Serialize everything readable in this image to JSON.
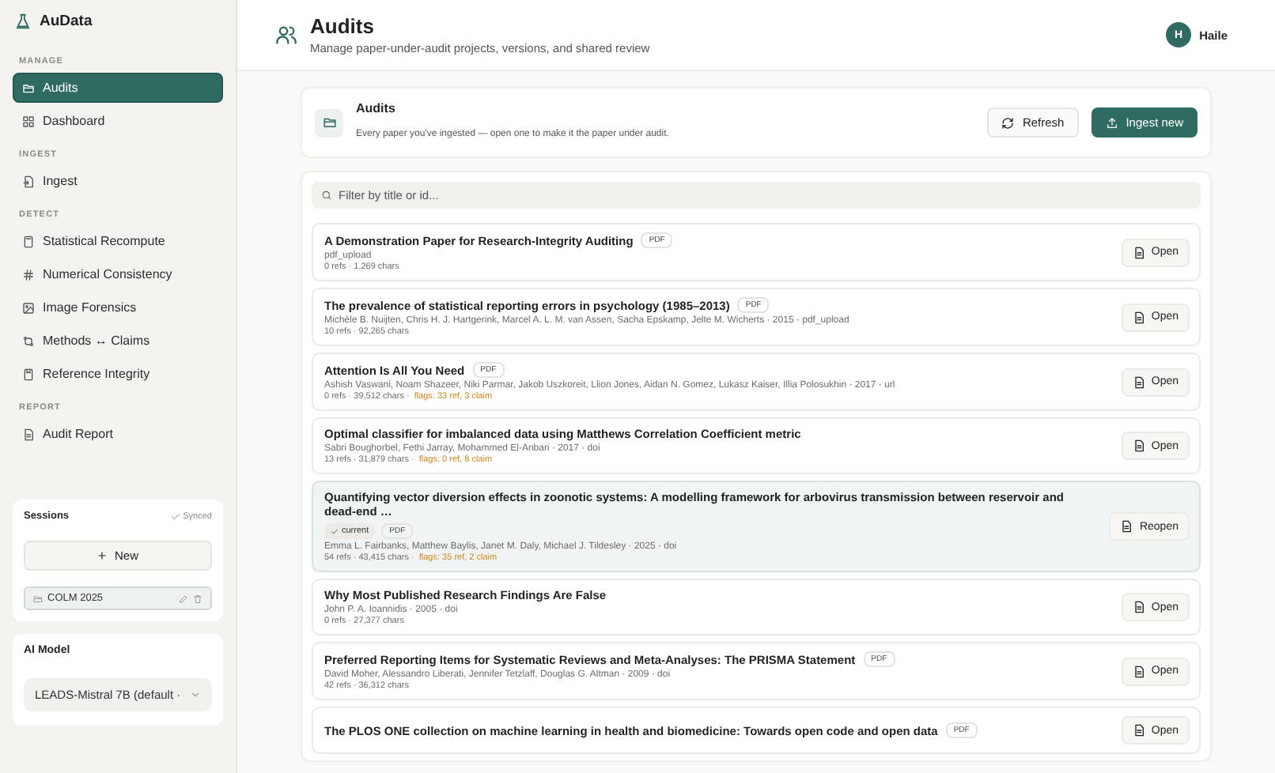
{
  "brand": {
    "name": "AuData"
  },
  "sidebar": {
    "sections": [
      {
        "heading": "MANAGE",
        "items": [
          {
            "label": "Audits",
            "selected": true
          },
          {
            "label": "Dashboard",
            "selected": false
          }
        ]
      },
      {
        "heading": "INGEST",
        "items": [
          {
            "label": "Ingest",
            "selected": false
          }
        ]
      },
      {
        "heading": "DETECT",
        "items": [
          {
            "label": "Statistical Recompute",
            "selected": false
          },
          {
            "label": "Numerical Consistency",
            "selected": false
          },
          {
            "label": "Image Forensics",
            "selected": false
          },
          {
            "label": "Methods ↔ Claims",
            "selected": false
          },
          {
            "label": "Reference Integrity",
            "selected": false
          }
        ]
      },
      {
        "heading": "REPORT",
        "items": [
          {
            "label": "Audit Report",
            "selected": false
          }
        ]
      }
    ]
  },
  "sessions": {
    "title": "Sessions",
    "status": "Synced",
    "new_button": "New",
    "items": [
      {
        "label": "COLM 2025",
        "selected": true
      }
    ]
  },
  "ai_model": {
    "title": "AI Model",
    "value": "LEADS-Mistral 7B (default ·"
  },
  "header": {
    "title": "Audits",
    "subtitle": "Manage paper-under-audit projects, versions, and shared review",
    "user": {
      "initial": "H",
      "name": "Haile"
    }
  },
  "panel": {
    "title": "Audits",
    "subtitle": "Every paper you've ingested — open one to make it the paper under audit.",
    "refresh_button": "Refresh",
    "ingest_button": "Ingest new",
    "search": {
      "placeholder": "Filter by title or id..."
    },
    "papers": [
      {
        "title": "A Demonstration Paper for Research-Integrity Auditing",
        "pdf_badge": "PDF",
        "meta": "pdf_upload",
        "stats": "0 refs · 1,269 chars",
        "action": "Open",
        "selected": false
      },
      {
        "title": "The prevalence of statistical reporting errors in psychology (1985–2013)",
        "pdf_badge": "PDF",
        "meta": "Michèle B. Nuijten, Chris H. J. Hartgerink, Marcel A. L. M. van Assen, Sacha Epskamp, Jelte M. Wicherts · 2015 · pdf_upload",
        "stats": "10 refs · 92,265 chars",
        "action": "Open",
        "selected": false
      },
      {
        "title": "Attention Is All You Need",
        "pdf_badge": "PDF",
        "meta": "Ashish Vaswani, Noam Shazeer, Niki Parmar, Jakob Uszkoreit, Llion Jones, Aidan N. Gomez, Lukasz Kaiser, Illia Polosukhin · 2017 · url",
        "stats": "0 refs · 39,512 chars ·",
        "flags": "flags: 33 ref, 3 claim",
        "action": "Open",
        "selected": false
      },
      {
        "title": "Optimal classifier for imbalanced data using Matthews Correlation Coefficient metric",
        "meta": "Sabri Boughorbel, Fethi Jarray, Mohammed El-Anbari · 2017 · doi",
        "stats": "13 refs · 31,879 chars ·",
        "flags": "flags: 0 ref, 8 claim",
        "action": "Open",
        "selected": false
      },
      {
        "title": "Quantifying vector diversion effects in zoonotic systems: A modelling framework for arbovirus transmission between reservoir and dead-end …",
        "current_badge": "current",
        "pdf_badge": "PDF",
        "meta": "Emma L. Fairbanks, Matthew Baylis, Janet M. Daly, Michael J. Tildesley · 2025 · doi",
        "stats": "54 refs · 43,415 chars ·",
        "flags": "flags: 35 ref, 2 claim",
        "action": "Reopen",
        "selected": true
      },
      {
        "title": "Why Most Published Research Findings Are False",
        "meta": "John P. A. Ioannidis · 2005 · doi",
        "stats": "0 refs · 27,377 chars",
        "action": "Open",
        "selected": false
      },
      {
        "title": "Preferred Reporting Items for Systematic Reviews and Meta-Analyses: The PRISMA Statement",
        "pdf_badge": "PDF",
        "meta": "David Moher, Alessandro Liberati, Jennifer Tetzlaff, Douglas G. Altman · 2009 · doi",
        "stats": "42 refs · 36,312 chars",
        "action": "Open",
        "selected": false
      },
      {
        "title": "The PLOS ONE collection on machine learning in health and biomedicine: Towards open code and open data",
        "pdf_badge": "PDF",
        "action": "Open",
        "selected": false
      }
    ]
  }
}
